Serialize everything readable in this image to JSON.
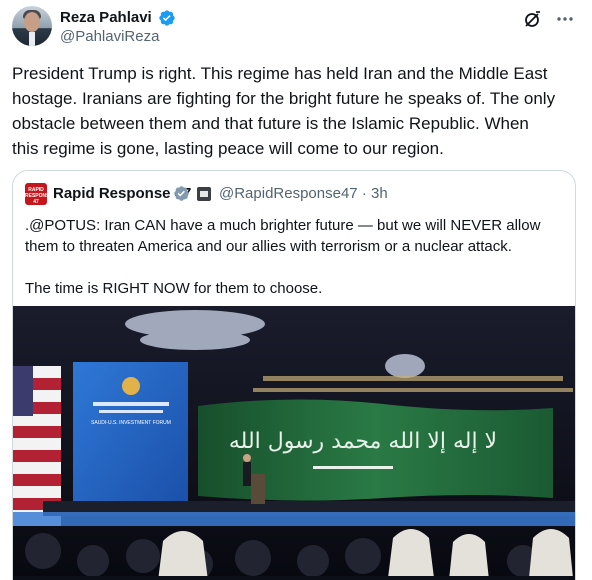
{
  "author": {
    "display_name": "Reza Pahlavi",
    "handle": "@PahlaviReza",
    "verified": true
  },
  "tweet": {
    "text": "President Trump is right. This regime has held Iran and the Middle East\nhostage. Iranians are fighting for the bright future he speaks of. The only\nobstacle between them and that future is the Islamic Republic. When\nthis regime is gone, lasting peace will come to our region."
  },
  "quoted": {
    "avatar_label": "RAPID RESPONSE 47",
    "display_name": "Rapid Response 47",
    "handle_time": "@RapidResponse47 · 3h",
    "text": ".@POTUS: Iran CAN have a much brighter future — but we will NEVER allow\nthem to threaten America and our allies with terrorism or a nuclear attack.\n\nThe time is RIGHT NOW for them to choose."
  },
  "media": {
    "screen_title": "SAUDI-U.S. INVESTMENT FORUM",
    "flag_script": "لا إله إلا الله محمد رسول الله"
  },
  "colors": {
    "verified_blue": "#1d9bf0",
    "text_secondary": "#536471",
    "border": "#cfd9de",
    "saudi_green": "#1f6b3a"
  },
  "icons": {
    "grok": "grok-icon",
    "more": "more-icon",
    "verified": "verified-badge-icon",
    "government": "government-badge-icon"
  }
}
